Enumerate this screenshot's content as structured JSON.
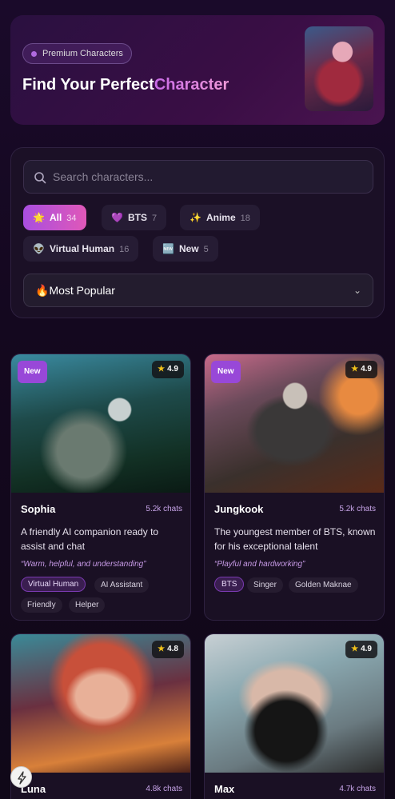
{
  "hero": {
    "badge": "Premium Characters",
    "title_prefix": "Find Your Perfect",
    "title_accent": "Character"
  },
  "search": {
    "placeholder": "Search characters..."
  },
  "filters": [
    {
      "icon": "🌟",
      "label": "All",
      "count": "34"
    },
    {
      "icon": "💜",
      "label": "BTS",
      "count": "7"
    },
    {
      "icon": "✨",
      "label": "Anime",
      "count": "18"
    },
    {
      "icon": "👽",
      "label": "Virtual Human",
      "count": "16"
    },
    {
      "icon": "🆕",
      "label": "New",
      "count": "5"
    }
  ],
  "sort": {
    "icon": "🔥",
    "label": "Most Popular"
  },
  "cards": [
    {
      "badge": "New",
      "rating": "4.9",
      "name": "Sophia",
      "chats": "5.2k chats",
      "desc": "A friendly AI companion ready to assist and chat",
      "quote": "“Warm, helpful, and understanding”",
      "tags": [
        "Virtual Human",
        "AI Assistant",
        "Friendly",
        "Helper"
      ]
    },
    {
      "badge": "New",
      "rating": "4.9",
      "name": "Jungkook",
      "chats": "5.2k chats",
      "desc": "The youngest member of BTS, known for his exceptional talent",
      "quote": "“Playful and hardworking”",
      "tags": [
        "BTS",
        "Singer",
        "Golden Maknae"
      ]
    },
    {
      "rating": "4.8",
      "name": "Luna",
      "chats": "4.8k chats"
    },
    {
      "rating": "4.9",
      "name": "Max",
      "chats": "4.7k chats"
    }
  ],
  "colors": {
    "accent": "#a84ee0",
    "accent2": "#e058b8",
    "star": "#f2c21a"
  }
}
